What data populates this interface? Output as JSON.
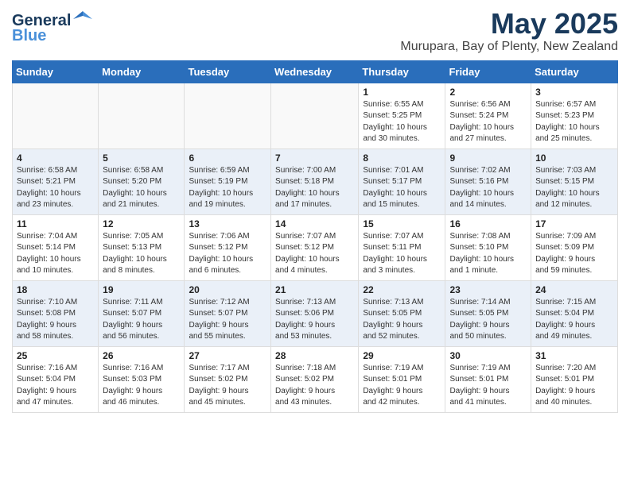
{
  "header": {
    "logo_line1": "General",
    "logo_line2": "Blue",
    "month": "May 2025",
    "location": "Murupara, Bay of Plenty, New Zealand"
  },
  "days_of_week": [
    "Sunday",
    "Monday",
    "Tuesday",
    "Wednesday",
    "Thursday",
    "Friday",
    "Saturday"
  ],
  "weeks": [
    [
      {
        "day": "",
        "info": ""
      },
      {
        "day": "",
        "info": ""
      },
      {
        "day": "",
        "info": ""
      },
      {
        "day": "",
        "info": ""
      },
      {
        "day": "1",
        "info": "Sunrise: 6:55 AM\nSunset: 5:25 PM\nDaylight: 10 hours\nand 30 minutes."
      },
      {
        "day": "2",
        "info": "Sunrise: 6:56 AM\nSunset: 5:24 PM\nDaylight: 10 hours\nand 27 minutes."
      },
      {
        "day": "3",
        "info": "Sunrise: 6:57 AM\nSunset: 5:23 PM\nDaylight: 10 hours\nand 25 minutes."
      }
    ],
    [
      {
        "day": "4",
        "info": "Sunrise: 6:58 AM\nSunset: 5:21 PM\nDaylight: 10 hours\nand 23 minutes."
      },
      {
        "day": "5",
        "info": "Sunrise: 6:58 AM\nSunset: 5:20 PM\nDaylight: 10 hours\nand 21 minutes."
      },
      {
        "day": "6",
        "info": "Sunrise: 6:59 AM\nSunset: 5:19 PM\nDaylight: 10 hours\nand 19 minutes."
      },
      {
        "day": "7",
        "info": "Sunrise: 7:00 AM\nSunset: 5:18 PM\nDaylight: 10 hours\nand 17 minutes."
      },
      {
        "day": "8",
        "info": "Sunrise: 7:01 AM\nSunset: 5:17 PM\nDaylight: 10 hours\nand 15 minutes."
      },
      {
        "day": "9",
        "info": "Sunrise: 7:02 AM\nSunset: 5:16 PM\nDaylight: 10 hours\nand 14 minutes."
      },
      {
        "day": "10",
        "info": "Sunrise: 7:03 AM\nSunset: 5:15 PM\nDaylight: 10 hours\nand 12 minutes."
      }
    ],
    [
      {
        "day": "11",
        "info": "Sunrise: 7:04 AM\nSunset: 5:14 PM\nDaylight: 10 hours\nand 10 minutes."
      },
      {
        "day": "12",
        "info": "Sunrise: 7:05 AM\nSunset: 5:13 PM\nDaylight: 10 hours\nand 8 minutes."
      },
      {
        "day": "13",
        "info": "Sunrise: 7:06 AM\nSunset: 5:12 PM\nDaylight: 10 hours\nand 6 minutes."
      },
      {
        "day": "14",
        "info": "Sunrise: 7:07 AM\nSunset: 5:12 PM\nDaylight: 10 hours\nand 4 minutes."
      },
      {
        "day": "15",
        "info": "Sunrise: 7:07 AM\nSunset: 5:11 PM\nDaylight: 10 hours\nand 3 minutes."
      },
      {
        "day": "16",
        "info": "Sunrise: 7:08 AM\nSunset: 5:10 PM\nDaylight: 10 hours\nand 1 minute."
      },
      {
        "day": "17",
        "info": "Sunrise: 7:09 AM\nSunset: 5:09 PM\nDaylight: 9 hours\nand 59 minutes."
      }
    ],
    [
      {
        "day": "18",
        "info": "Sunrise: 7:10 AM\nSunset: 5:08 PM\nDaylight: 9 hours\nand 58 minutes."
      },
      {
        "day": "19",
        "info": "Sunrise: 7:11 AM\nSunset: 5:07 PM\nDaylight: 9 hours\nand 56 minutes."
      },
      {
        "day": "20",
        "info": "Sunrise: 7:12 AM\nSunset: 5:07 PM\nDaylight: 9 hours\nand 55 minutes."
      },
      {
        "day": "21",
        "info": "Sunrise: 7:13 AM\nSunset: 5:06 PM\nDaylight: 9 hours\nand 53 minutes."
      },
      {
        "day": "22",
        "info": "Sunrise: 7:13 AM\nSunset: 5:05 PM\nDaylight: 9 hours\nand 52 minutes."
      },
      {
        "day": "23",
        "info": "Sunrise: 7:14 AM\nSunset: 5:05 PM\nDaylight: 9 hours\nand 50 minutes."
      },
      {
        "day": "24",
        "info": "Sunrise: 7:15 AM\nSunset: 5:04 PM\nDaylight: 9 hours\nand 49 minutes."
      }
    ],
    [
      {
        "day": "25",
        "info": "Sunrise: 7:16 AM\nSunset: 5:04 PM\nDaylight: 9 hours\nand 47 minutes."
      },
      {
        "day": "26",
        "info": "Sunrise: 7:16 AM\nSunset: 5:03 PM\nDaylight: 9 hours\nand 46 minutes."
      },
      {
        "day": "27",
        "info": "Sunrise: 7:17 AM\nSunset: 5:02 PM\nDaylight: 9 hours\nand 45 minutes."
      },
      {
        "day": "28",
        "info": "Sunrise: 7:18 AM\nSunset: 5:02 PM\nDaylight: 9 hours\nand 43 minutes."
      },
      {
        "day": "29",
        "info": "Sunrise: 7:19 AM\nSunset: 5:01 PM\nDaylight: 9 hours\nand 42 minutes."
      },
      {
        "day": "30",
        "info": "Sunrise: 7:19 AM\nSunset: 5:01 PM\nDaylight: 9 hours\nand 41 minutes."
      },
      {
        "day": "31",
        "info": "Sunrise: 7:20 AM\nSunset: 5:01 PM\nDaylight: 9 hours\nand 40 minutes."
      }
    ]
  ]
}
